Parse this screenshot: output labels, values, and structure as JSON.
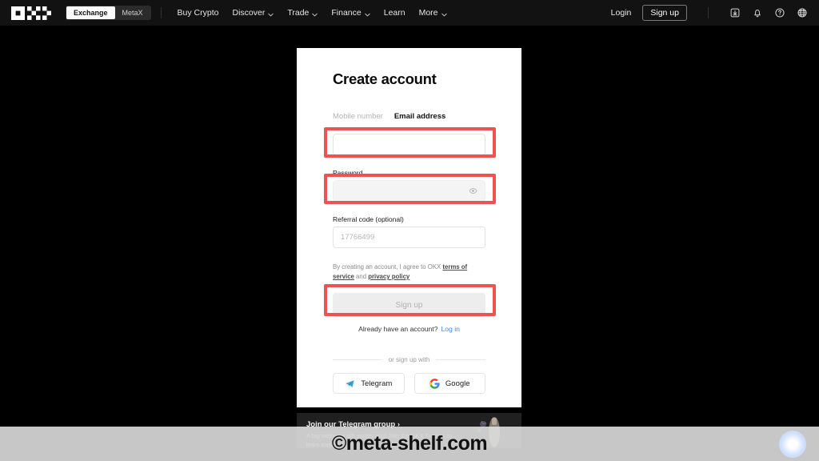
{
  "navbar": {
    "logo_name": "okx-logo",
    "segments": [
      {
        "label": "Exchange",
        "active": true
      },
      {
        "label": "MetaX",
        "active": false
      }
    ],
    "links": [
      {
        "label": "Buy Crypto",
        "caret": false
      },
      {
        "label": "Discover",
        "caret": true
      },
      {
        "label": "Trade",
        "caret": true
      },
      {
        "label": "Finance",
        "caret": true
      },
      {
        "label": "Learn",
        "caret": false
      },
      {
        "label": "More",
        "caret": true
      }
    ],
    "login_label": "Login",
    "signup_label": "Sign up",
    "icons": [
      {
        "name": "download-icon"
      },
      {
        "name": "bell-icon"
      },
      {
        "name": "help-circle-icon"
      },
      {
        "name": "globe-icon"
      }
    ]
  },
  "card": {
    "title": "Create account",
    "tabs": [
      {
        "label": "Mobile number",
        "active": false
      },
      {
        "label": "Email address",
        "active": true
      }
    ],
    "email": {
      "value": "",
      "placeholder": ""
    },
    "password": {
      "label": "Password",
      "value": "",
      "placeholder": "",
      "toggle_icon": "eye-icon"
    },
    "referral": {
      "label": "Referral code (optional)",
      "value": "17766499"
    },
    "terms": {
      "prefix": "By creating an account, I agree to OKX ",
      "link1": "terms of service",
      "middle": " and ",
      "link2": "privacy policy"
    },
    "submit_label": "Sign up",
    "have_account_text": "Already have an account?",
    "login_link_label": "Log in",
    "or_divider_label": "or sign up with",
    "social": [
      {
        "label": "Telegram",
        "icon": "telegram-icon"
      },
      {
        "label": "Google",
        "icon": "google-icon"
      }
    ]
  },
  "telegram_banner": {
    "title": "Join our Telegram group ›",
    "subtitle": "A big welcome gift awaits you! Join the OKX Traders to learn trading."
  },
  "watermark": {
    "text": "©meta-shelf.com"
  },
  "chat_widget": {
    "name": "chat-bubble-icon"
  },
  "annotations": {
    "color": "#ef5350",
    "boxes": [
      {
        "target": "email-input"
      },
      {
        "target": "password-input"
      },
      {
        "target": "signup-submit-button"
      }
    ]
  }
}
